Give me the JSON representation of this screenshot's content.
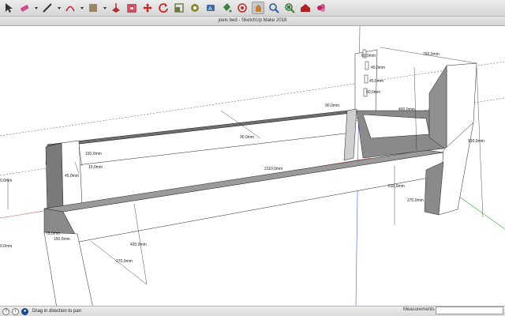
{
  "window": {
    "title": "joels bed - SketchUp Make 2018"
  },
  "toolbar": {
    "tools": [
      {
        "name": "select-tool-icon",
        "color": "#333333"
      },
      {
        "name": "eraser-tool-icon",
        "color": "#d04a8c"
      },
      {
        "name": "line-tool-icon",
        "color": "#333333"
      },
      {
        "name": "arc-tool-icon",
        "color": "#c0203a"
      },
      {
        "name": "rectangle-tool-icon",
        "color": "#8a6f4a"
      },
      {
        "name": "push-pull-tool-icon",
        "color": "#b03030"
      },
      {
        "name": "offset-tool-icon",
        "color": "#c0203a"
      },
      {
        "name": "move-tool-icon",
        "color": "#d02020"
      },
      {
        "name": "rotate-tool-icon",
        "color": "#d02020"
      },
      {
        "name": "scale-tool-icon",
        "color": "#6a7a3a"
      },
      {
        "name": "tape-measure-tool-icon",
        "color": "#8a8a30"
      },
      {
        "name": "text-tool-icon",
        "color": "#3a6aa0"
      },
      {
        "name": "paint-bucket-tool-icon",
        "color": "#3a8040"
      },
      {
        "name": "orbit-tool-icon",
        "color": "#c03030"
      },
      {
        "name": "pan-tool-icon",
        "color": "#c08040"
      },
      {
        "name": "zoom-tool-icon",
        "color": "#2a5a9a"
      },
      {
        "name": "zoom-extents-tool-icon",
        "color": "#3a7a3a"
      },
      {
        "name": "warehouse-tool-icon",
        "color": "#b02020"
      },
      {
        "name": "extension-warehouse-tool-icon",
        "color": "#c02060"
      }
    ]
  },
  "dimensions": {
    "d760": "760,0mm",
    "d400": "400,0mm",
    "d910": "910,0mm",
    "d90a": "90,0mm",
    "d90b": "90,0mm",
    "d150a": "150,0mm",
    "d150b": "150,0mm",
    "d15": "15,0mm",
    "d2110": "2110,0mm",
    "d45": "45,0mm",
    "d610": "610,0mm",
    "d270a": "270,0mm",
    "d270b": "270,0mm",
    "d420": "420,0mm",
    "d75": "75,0mm",
    "dleft": "0,0mm",
    "dmid": "0,0mm",
    "sl1": "60,0mm",
    "sl2": "40,0mm",
    "sl3": "45,0mm",
    "sl4": "60,0mm"
  },
  "status": {
    "hint": "Drag in direction to pan",
    "measurements_label": "Measurements",
    "measurements_value": ""
  }
}
